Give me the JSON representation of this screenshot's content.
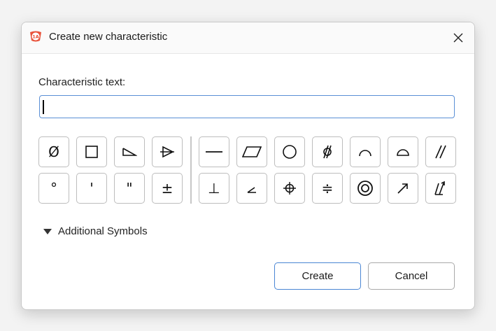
{
  "dialog": {
    "title": "Create new characteristic",
    "app_icon_text": "1A",
    "close_label": "✕"
  },
  "field": {
    "label": "Characteristic text:",
    "value": "",
    "placeholder": ""
  },
  "symbols_left_row1": [
    "Ø",
    "□",
    "flag",
    "flag-tri"
  ],
  "symbols_left_row2": [
    "°",
    "'",
    "\"",
    "±"
  ],
  "symbols_right_row1": [
    "straightness",
    "flatness",
    "circularity",
    "cylindricity",
    "line-profile",
    "surface-profile",
    "parallelism"
  ],
  "symbols_right_row2": [
    "perpendicularity",
    "angularity",
    "position",
    "symmetry",
    "concentricity",
    "circular-runout",
    "total-runout"
  ],
  "symbol_text": {
    "diameter": "Ø",
    "degree": "°",
    "minute": "'",
    "second": "\"",
    "plusminus": "±",
    "perpendicular": "⊥",
    "symmetry": "≑"
  },
  "additional_symbols": "Additional Symbols",
  "buttons": {
    "create": "Create",
    "cancel": "Cancel"
  },
  "colors": {
    "accent": "#4a86d4",
    "app_icon": "#e8523a"
  }
}
